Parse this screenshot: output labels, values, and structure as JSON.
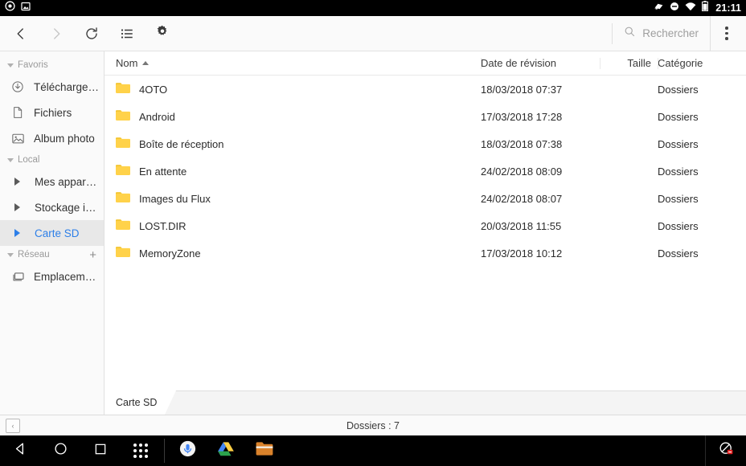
{
  "status_bar": {
    "icons_left": [
      "camera-icon",
      "screenshot-icon"
    ],
    "icons_right": [
      "cast-icon",
      "do-not-disturb-icon",
      "wifi-icon",
      "battery-icon"
    ],
    "clock": "21:11"
  },
  "toolbar": {
    "back_label": "‹",
    "forward_label": "›",
    "refresh_name": "refresh-icon",
    "list_view_name": "list-view-icon",
    "settings_name": "gear-icon",
    "search_placeholder": "Rechercher",
    "overflow_name": "overflow-menu-icon"
  },
  "sidebar": {
    "groups": [
      {
        "label": "Favoris",
        "has_add": false,
        "items": [
          {
            "label": "Télécharge…",
            "icon": "download-icon",
            "selected": false,
            "expandable": false
          },
          {
            "label": "Fichiers",
            "icon": "file-icon",
            "selected": false,
            "expandable": false
          },
          {
            "label": "Album photo",
            "icon": "photo-icon",
            "selected": false,
            "expandable": false
          }
        ]
      },
      {
        "label": "Local",
        "has_add": false,
        "items": [
          {
            "label": "Mes appar…",
            "icon": "triangle-right-icon",
            "selected": false,
            "expandable": true
          },
          {
            "label": "Stockage i…",
            "icon": "triangle-right-icon",
            "selected": false,
            "expandable": true
          },
          {
            "label": "Carte SD",
            "icon": "triangle-right-icon",
            "selected": true,
            "expandable": true
          }
        ]
      },
      {
        "label": "Réseau",
        "has_add": true,
        "add_label": "+",
        "items": [
          {
            "label": "Emplacem…",
            "icon": "network-computer-icon",
            "selected": false,
            "expandable": false
          }
        ]
      }
    ]
  },
  "file_table": {
    "columns": [
      {
        "key": "name",
        "label": "Nom",
        "sorted": "asc"
      },
      {
        "key": "date",
        "label": "Date de révision",
        "sorted": ""
      },
      {
        "key": "size",
        "label": "Taille",
        "sorted": ""
      },
      {
        "key": "category",
        "label": "Catégorie",
        "sorted": ""
      }
    ],
    "rows": [
      {
        "name": "4OTO",
        "date": "18/03/2018 07:37",
        "size": "",
        "category": "Dossiers",
        "icon": "folder-icon"
      },
      {
        "name": "Android",
        "date": "17/03/2018 17:28",
        "size": "",
        "category": "Dossiers",
        "icon": "folder-icon"
      },
      {
        "name": "Boîte de réception",
        "date": "18/03/2018 07:38",
        "size": "",
        "category": "Dossiers",
        "icon": "folder-icon"
      },
      {
        "name": "En attente",
        "date": "24/02/2018 08:09",
        "size": "",
        "category": "Dossiers",
        "icon": "folder-icon"
      },
      {
        "name": "Images du Flux",
        "date": "24/02/2018 08:07",
        "size": "",
        "category": "Dossiers",
        "icon": "folder-icon"
      },
      {
        "name": "LOST.DIR",
        "date": "20/03/2018 11:55",
        "size": "",
        "category": "Dossiers",
        "icon": "folder-icon"
      },
      {
        "name": "MemoryZone",
        "date": "17/03/2018 10:12",
        "size": "",
        "category": "Dossiers",
        "icon": "folder-icon"
      }
    ]
  },
  "tabs": {
    "active_label": "Carte SD"
  },
  "footer": {
    "back_label": "‹",
    "count_label": "Dossiers : 7"
  },
  "navbar": {
    "back_name": "nav-back-triangle-icon",
    "home_name": "nav-home-circle-icon",
    "recents_name": "nav-recents-square-icon",
    "apps_name": "nav-all-apps-icon",
    "dock": [
      {
        "name": "google-assistant-icon"
      },
      {
        "name": "google-drive-icon"
      },
      {
        "name": "file-manager-icon"
      }
    ],
    "right_name": "notification-blocked-icon"
  },
  "colors": {
    "accent": "#2d7fe8",
    "folder": "#FFD24A",
    "folder_dark": "#F5C518",
    "toolbar_bg": "#fafafa",
    "sidebar_selected_bg": "#e8e8e8",
    "status_bg": "#000000"
  }
}
